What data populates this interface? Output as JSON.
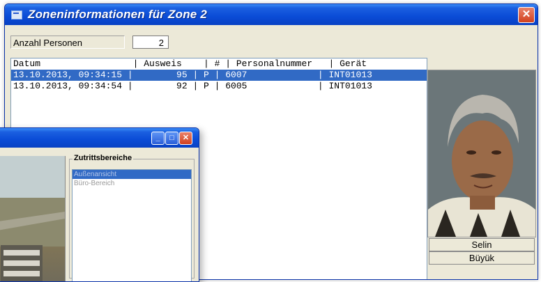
{
  "window": {
    "title": "Zoneninformationen für Zone 2",
    "close_glyph": "✕"
  },
  "count": {
    "label": "Anzahl Personen",
    "value": "2"
  },
  "list": {
    "header": "Datum                 | Ausweis    | # | Personalnummer   | Gerät",
    "rows": [
      {
        "text": "13.10.2013, 09:34:15 |        95 | P | 6007             | INT01013",
        "selected": true
      },
      {
        "text": "13.10.2013, 09:34:54 |        92 | P | 6005             | INT01013",
        "selected": false
      }
    ]
  },
  "person": {
    "first_name": "Selin",
    "last_name": "Büyük"
  },
  "sub_window": {
    "minimize_glyph": "_",
    "maximize_glyph": "□",
    "close_glyph": "✕",
    "group_title": "Zutrittsbereiche",
    "areas": [
      "Außenansicht",
      "Büro-Bereich"
    ]
  }
}
